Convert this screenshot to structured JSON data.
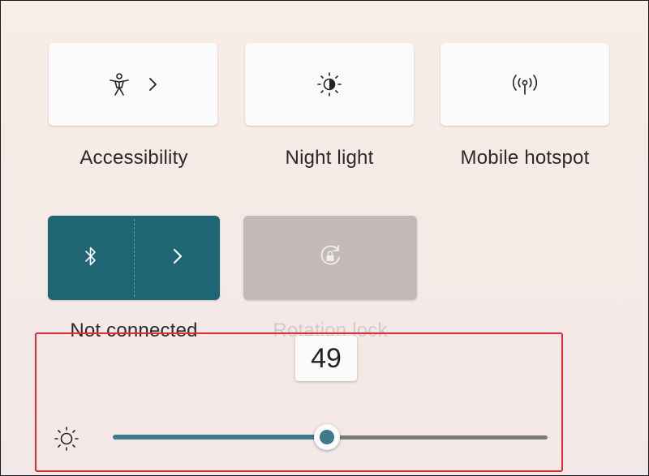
{
  "quick_settings": {
    "tiles": [
      {
        "label": "Accessibility",
        "icon": "accessibility-icon",
        "has_chevron": true,
        "state": "off"
      },
      {
        "label": "Night light",
        "icon": "night-light-icon",
        "has_chevron": false,
        "state": "off"
      },
      {
        "label": "Mobile hotspot",
        "icon": "hotspot-icon",
        "has_chevron": false,
        "state": "off"
      },
      {
        "label": "Not connected",
        "icon": "bluetooth-icon",
        "has_chevron": true,
        "state": "on"
      },
      {
        "label": "Rotation lock",
        "icon": "rotation-lock-icon",
        "has_chevron": false,
        "state": "disabled"
      }
    ]
  },
  "brightness": {
    "value": "49",
    "level_percent": 49,
    "icon": "sun-icon"
  },
  "colors": {
    "accent": "#1f6574",
    "slider_fill": "#3e7a88",
    "highlight_box": "#e22b36",
    "disabled_tile": "#c3b9b8"
  }
}
